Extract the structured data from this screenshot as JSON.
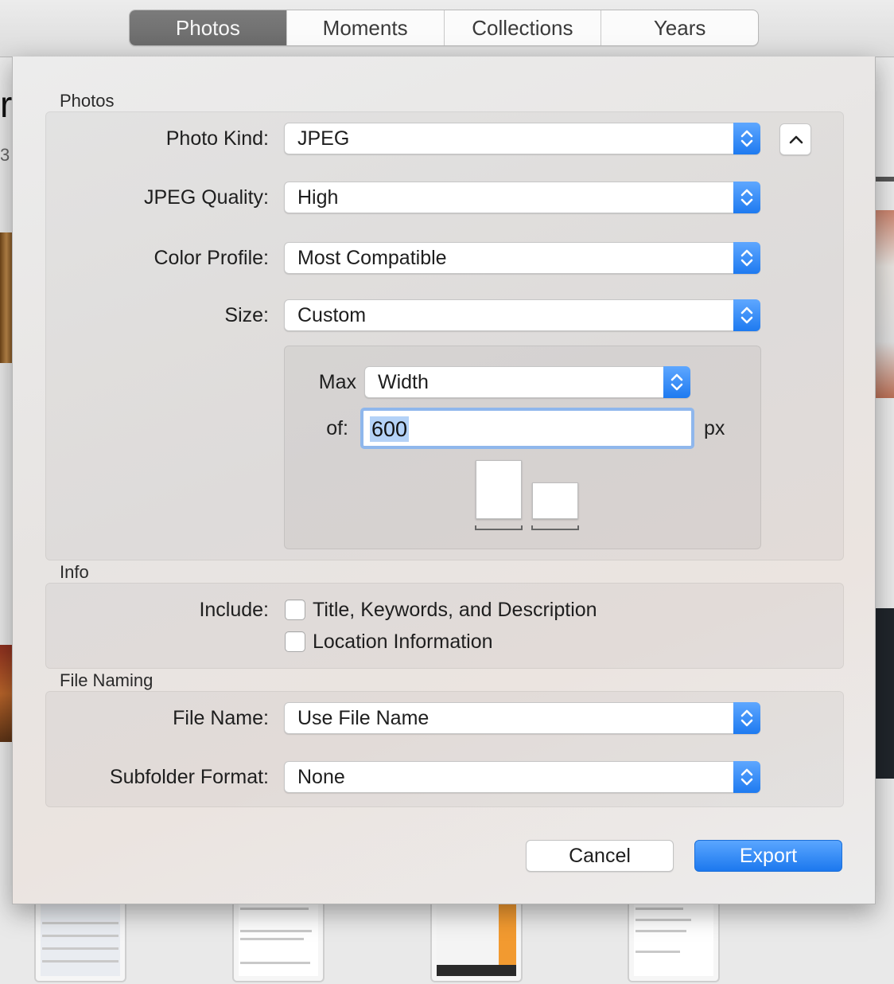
{
  "toolbar": {
    "tabs": [
      {
        "label": "Photos",
        "active": true
      },
      {
        "label": "Moments",
        "active": false
      },
      {
        "label": "Collections",
        "active": false
      },
      {
        "label": "Years",
        "active": false
      }
    ]
  },
  "dialog": {
    "photos_section": {
      "title": "Photos",
      "photo_kind": {
        "label": "Photo Kind:",
        "value": "JPEG"
      },
      "jpeg_quality": {
        "label": "JPEG Quality:",
        "value": "High"
      },
      "color_profile": {
        "label": "Color Profile:",
        "value": "Most Compatible"
      },
      "size": {
        "label": "Size:",
        "value": "Custom"
      },
      "max": {
        "label": "Max",
        "value": "Width"
      },
      "of": {
        "label": "of:",
        "value": "600",
        "unit": "px"
      }
    },
    "info_section": {
      "title": "Info",
      "include_label": "Include:",
      "options": [
        {
          "label": "Title, Keywords, and Description",
          "checked": false
        },
        {
          "label": "Location Information",
          "checked": false
        }
      ]
    },
    "file_naming_section": {
      "title": "File Naming",
      "file_name": {
        "label": "File Name:",
        "value": "Use File Name"
      },
      "subfolder_format": {
        "label": "Subfolder Format:",
        "value": "None"
      }
    },
    "buttons": {
      "cancel": "Cancel",
      "export": "Export"
    }
  },
  "colors": {
    "accent": "#1e7af0",
    "selection": "#b4d2f7",
    "focus_ring": "#8fb7ec"
  },
  "icons": {
    "popup_arrows": "up-down-chevrons-icon",
    "disclosure": "chevron-up-icon"
  }
}
